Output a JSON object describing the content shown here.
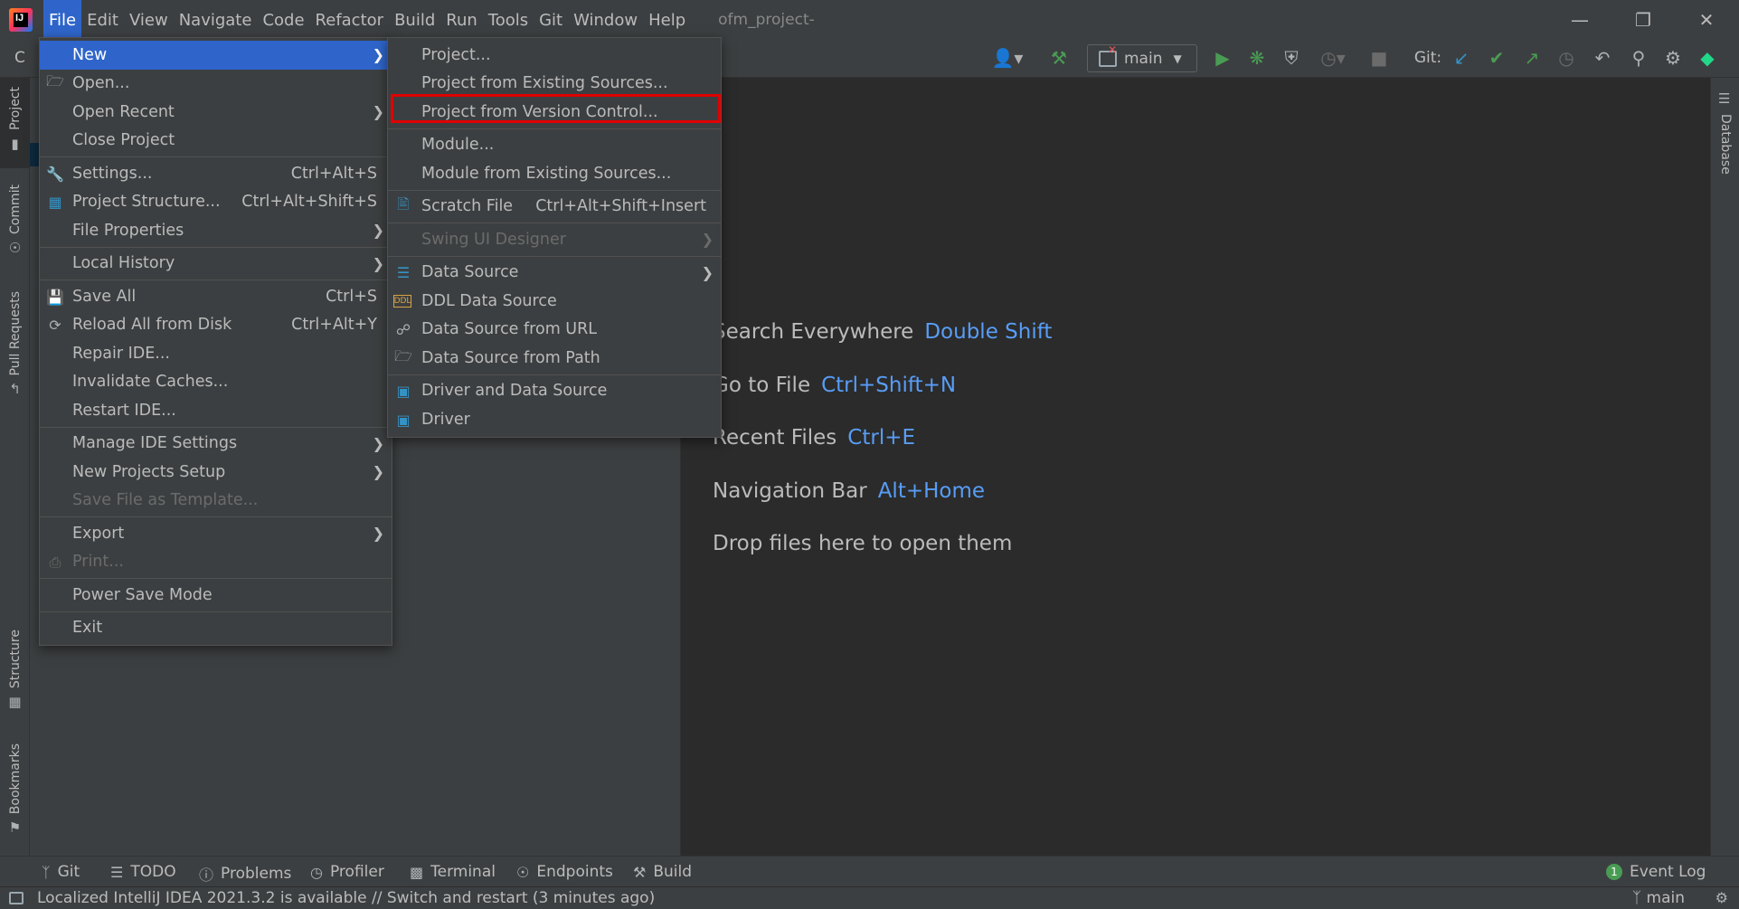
{
  "app": {
    "logo_text": "IJ",
    "window_title": "ofm_project-"
  },
  "menubar": [
    "File",
    "Edit",
    "View",
    "Navigate",
    "Code",
    "Refactor",
    "Build",
    "Run",
    "Tools",
    "Git",
    "Window",
    "Help"
  ],
  "toolbar": {
    "branch": "main",
    "git_label": "Git:",
    "left_cut_label": "C"
  },
  "file_menu": {
    "new": "New",
    "open": "Open...",
    "open_recent": "Open Recent",
    "close_project": "Close Project",
    "settings": "Settings...",
    "settings_short": "Ctrl+Alt+S",
    "project_structure": "Project Structure...",
    "project_structure_short": "Ctrl+Alt+Shift+S",
    "file_properties": "File Properties",
    "local_history": "Local History",
    "save_all": "Save All",
    "save_all_short": "Ctrl+S",
    "reload_all": "Reload All from Disk",
    "reload_all_short": "Ctrl+Alt+Y",
    "repair_ide": "Repair IDE...",
    "invalidate_caches": "Invalidate Caches...",
    "restart_ide": "Restart IDE...",
    "manage_ide_settings": "Manage IDE Settings",
    "new_projects_setup": "New Projects Setup",
    "save_file_template": "Save File as Template...",
    "export": "Export",
    "print": "Print...",
    "power_save": "Power Save Mode",
    "exit": "Exit"
  },
  "new_menu": {
    "project": "Project...",
    "project_existing": "Project from Existing Sources...",
    "project_vcs": "Project from Version Control...",
    "module": "Module...",
    "module_existing": "Module from Existing Sources...",
    "scratch_file": "Scratch File",
    "scratch_file_short": "Ctrl+Alt+Shift+Insert",
    "swing_ui": "Swing UI Designer",
    "data_source": "Data Source",
    "ddl_data_source": "DDL Data Source",
    "data_source_url": "Data Source from URL",
    "data_source_path": "Data Source from Path",
    "driver_and_data_source": "Driver and Data Source",
    "driver": "Driver",
    "ddl_badge": "DDL"
  },
  "editor_hints": [
    {
      "label": "Search Everywhere",
      "key": "Double Shift"
    },
    {
      "label": "Go to File",
      "key": "Ctrl+Shift+N"
    },
    {
      "label": "Recent Files",
      "key": "Ctrl+E"
    },
    {
      "label": "Navigation Bar",
      "key": "Alt+Home"
    },
    {
      "label": "Drop files here to open them",
      "key": ""
    }
  ],
  "left_tabs": {
    "project": "Project",
    "commit": "Commit",
    "pull_requests": "Pull Requests",
    "structure": "Structure",
    "bookmarks": "Bookmarks"
  },
  "right_tabs": {
    "database": "Database"
  },
  "bottom_tabs": {
    "git": "Git",
    "todo": "TODO",
    "problems": "Problems",
    "profiler": "Profiler",
    "terminal": "Terminal",
    "endpoints": "Endpoints",
    "build": "Build",
    "event_log": "Event Log",
    "event_count": "1"
  },
  "status": {
    "message": "Localized IntelliJ IDEA 2021.3.2 is available // Switch and restart (3 minutes ago)",
    "branch": "main"
  },
  "colors": {
    "highlight": "#2f65ca",
    "accent_key": "#589df6",
    "red_box": "#e00000"
  }
}
